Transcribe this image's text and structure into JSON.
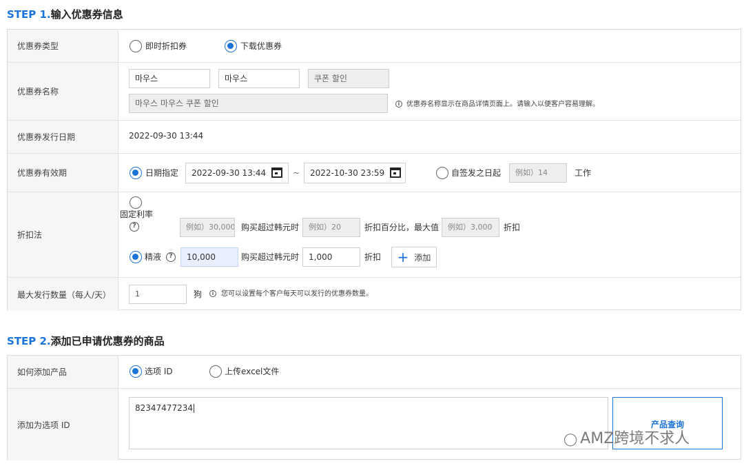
{
  "step1": {
    "number": "STEP 1.",
    "title": "输入优惠券信息",
    "coupon_type": {
      "label": "优惠券类型",
      "option_instant": "即时折扣券",
      "option_download": "下载优惠券"
    },
    "coupon_name": {
      "label": "优惠券名称",
      "field1": "마우스",
      "field2": "마우스",
      "field3": "쿠폰 할인",
      "combined": "마우스 마우스 쿠폰 할인",
      "note": "优惠券名称显示在商品详情页面上。请输入以便客户容易理解。"
    },
    "issue_date": {
      "label": "优惠券发行日期",
      "value": "2022-09-30 13:44"
    },
    "valid_period": {
      "label": "优惠券有效期",
      "option_date": "日期指定",
      "start": "2022-09-30 13:44",
      "separator": "~",
      "end": "2022-10-30 23:59",
      "option_days": "自签发之日起",
      "days_placeholder": "例如）14",
      "unit": "工作"
    },
    "discount": {
      "label": "折扣法",
      "fixed_label": "固定利率",
      "fixed_amount_placeholder": "例如）30,000",
      "buy_over_text": "购买超过韩元时",
      "fixed_percent_placeholder": "例如）20",
      "percent_max_text": "折扣百分比，最大值",
      "fixed_max_placeholder": "例如）3,000",
      "discount_text": "折扣",
      "amount_label": "精液",
      "amount_value": "10,000",
      "amount_buy_over_text": "购买超过韩元时",
      "amount_discount_value": "1,000",
      "amount_discount_text": "折扣",
      "add_button": "添加",
      "add_icon": "+"
    },
    "max_issue": {
      "label": "最大发行数量（每人/天）",
      "value": "1",
      "unit": "狗",
      "note": "您可以设置每个客户每天可以发行的优惠券数量。"
    }
  },
  "step2": {
    "number": "STEP 2.",
    "title": "添加已申请优惠券的商品",
    "how_to_add": {
      "label": "如何添加产品",
      "option_id": "选项 ID",
      "option_excel": "上传excel文件"
    },
    "add_option_id": {
      "label": "添加为选项 ID",
      "value": "82347477234",
      "query_button": "产品查询"
    }
  },
  "watermark": "AMZ跨境不求人",
  "colors": {
    "accent": "#1a73d9"
  }
}
